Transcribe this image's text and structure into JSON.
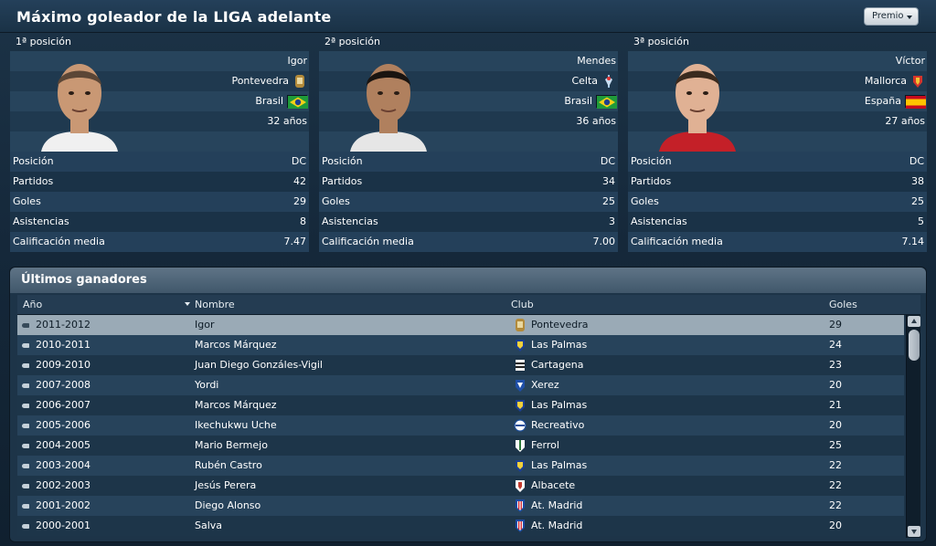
{
  "title": "Máximo goleador de la LIGA adelante",
  "premio_label": "Premio",
  "colors": {
    "accent": "#24405a",
    "selected_row": "#9aaab6"
  },
  "podium": [
    {
      "position_label": "1ª posición",
      "name": "Igor",
      "club": "Pontevedra",
      "club_crest": "pontevedra-crest",
      "nationality": "Brasil",
      "flag": "brazil-flag",
      "age": "32 años",
      "stats": [
        {
          "label": "Posición",
          "value": "DC"
        },
        {
          "label": "Partidos",
          "value": "42"
        },
        {
          "label": "Goles",
          "value": "29"
        },
        {
          "label": "Asistencias",
          "value": "8"
        },
        {
          "label": "Calificación media",
          "value": "7.47"
        }
      ]
    },
    {
      "position_label": "2ª posición",
      "name": "Mendes",
      "club": "Celta",
      "club_crest": "celta-crest",
      "nationality": "Brasil",
      "flag": "brazil-flag",
      "age": "36 años",
      "stats": [
        {
          "label": "Posición",
          "value": "DC"
        },
        {
          "label": "Partidos",
          "value": "34"
        },
        {
          "label": "Goles",
          "value": "25"
        },
        {
          "label": "Asistencias",
          "value": "3"
        },
        {
          "label": "Calificación media",
          "value": "7.00"
        }
      ]
    },
    {
      "position_label": "3ª posición",
      "name": "Víctor",
      "club": "Mallorca",
      "club_crest": "mallorca-crest",
      "nationality": "España",
      "flag": "spain-flag",
      "age": "27 años",
      "stats": [
        {
          "label": "Posición",
          "value": "DC"
        },
        {
          "label": "Partidos",
          "value": "38"
        },
        {
          "label": "Goles",
          "value": "25"
        },
        {
          "label": "Asistencias",
          "value": "5"
        },
        {
          "label": "Calificación media",
          "value": "7.14"
        }
      ]
    }
  ],
  "winners": {
    "title": "Últimos ganadores",
    "columns": [
      "Año",
      "Nombre",
      "Club",
      "Goles"
    ],
    "rows": [
      {
        "year": "2011-2012",
        "name": "Igor",
        "club": "Pontevedra",
        "crest": "pontevedra-crest",
        "goals": "29"
      },
      {
        "year": "2010-2011",
        "name": "Marcos Márquez",
        "club": "Las Palmas",
        "crest": "las-palmas-crest",
        "goals": "24"
      },
      {
        "year": "2009-2010",
        "name": "Juan Diego Gonzáles-Vigil",
        "club": "Cartagena",
        "crest": "cartagena-crest",
        "goals": "23"
      },
      {
        "year": "2007-2008",
        "name": "Yordi",
        "club": "Xerez",
        "crest": "xerez-crest",
        "goals": "20"
      },
      {
        "year": "2006-2007",
        "name": "Marcos Márquez",
        "club": "Las Palmas",
        "crest": "las-palmas-crest",
        "goals": "21"
      },
      {
        "year": "2005-2006",
        "name": "Ikechukwu Uche",
        "club": "Recreativo",
        "crest": "recreativo-crest",
        "goals": "20"
      },
      {
        "year": "2004-2005",
        "name": "Mario Bermejo",
        "club": "Ferrol",
        "crest": "ferrol-crest",
        "goals": "25"
      },
      {
        "year": "2003-2004",
        "name": "Rubén Castro",
        "club": "Las Palmas",
        "crest": "las-palmas-crest",
        "goals": "22"
      },
      {
        "year": "2002-2003",
        "name": "Jesús Perera",
        "club": "Albacete",
        "crest": "albacete-crest",
        "goals": "22"
      },
      {
        "year": "2001-2002",
        "name": "Diego Alonso",
        "club": "At. Madrid",
        "crest": "atletico-crest",
        "goals": "22"
      },
      {
        "year": "2000-2001",
        "name": "Salva",
        "club": "At. Madrid",
        "crest": "atletico-crest",
        "goals": "20"
      }
    ]
  }
}
